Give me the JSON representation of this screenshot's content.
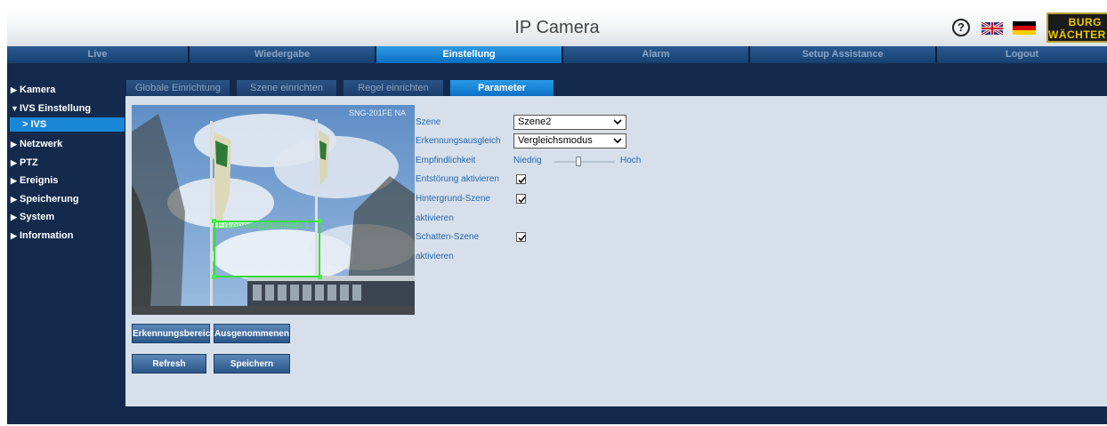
{
  "header": {
    "title": "IP Camera",
    "help_glyph": "?",
    "help_icon": "question-circle-icon",
    "logo_line1": "BURG",
    "logo_line2": "WÄCHTER",
    "colors": {
      "accent": "#0a6fc2",
      "navy": "#132a4c",
      "panel": "#d7e0ea",
      "zone": "#34e034",
      "logo_text": "#e8c900"
    }
  },
  "topnav": [
    {
      "label": "Live"
    },
    {
      "label": "Wiedergabe"
    },
    {
      "label": "Einstellung",
      "active": true
    },
    {
      "label": "Alarm"
    },
    {
      "label": "Setup Assistance"
    },
    {
      "label": "Logout"
    }
  ],
  "sidebar": {
    "items": [
      {
        "label": "Kamera",
        "expanded": false
      },
      {
        "label": "IVS Einstellung",
        "expanded": true
      },
      {
        "label": "IVS",
        "sub": true,
        "active": true
      },
      {
        "label": "Netzwerk",
        "expanded": false
      },
      {
        "label": "PTZ",
        "expanded": false
      },
      {
        "label": "Ereignis",
        "expanded": false
      },
      {
        "label": "Speicherung",
        "expanded": false
      },
      {
        "label": "System",
        "expanded": false
      },
      {
        "label": "Information",
        "expanded": false
      }
    ]
  },
  "subtabs": [
    {
      "label": "Globale Einrichtung"
    },
    {
      "label": "Szene einrichten"
    },
    {
      "label": "Regel einrichten"
    },
    {
      "label": "Parameter",
      "active": true
    }
  ],
  "video": {
    "camera_label": "SNG-201FE NA",
    "zone_label": "Erkennungsbereich 1"
  },
  "buttons": {
    "detection_area": "Erkennungsbereich",
    "excluded": "Ausgenommenen",
    "refresh": "Refresh",
    "save": "Speichern"
  },
  "form": {
    "scene_label": "Szene",
    "scene_value": "Szene2",
    "compensation_label": "Erkennungsausgleich",
    "compensation_value": "Vergleichsmodus",
    "sensitivity_label": "Empfindlichkeit",
    "sensitivity_low": "Niedrig",
    "sensitivity_high": "Hoch",
    "sensitivity_level": 0.4,
    "noise_label": "Entstörung aktivieren",
    "noise_checked": true,
    "background_label_1": "Hintergrund-Szene",
    "background_label_2": "aktivieren",
    "background_checked": true,
    "shadow_label_1": "Schatten-Szene",
    "shadow_label_2": "aktivieren",
    "shadow_checked": true
  }
}
